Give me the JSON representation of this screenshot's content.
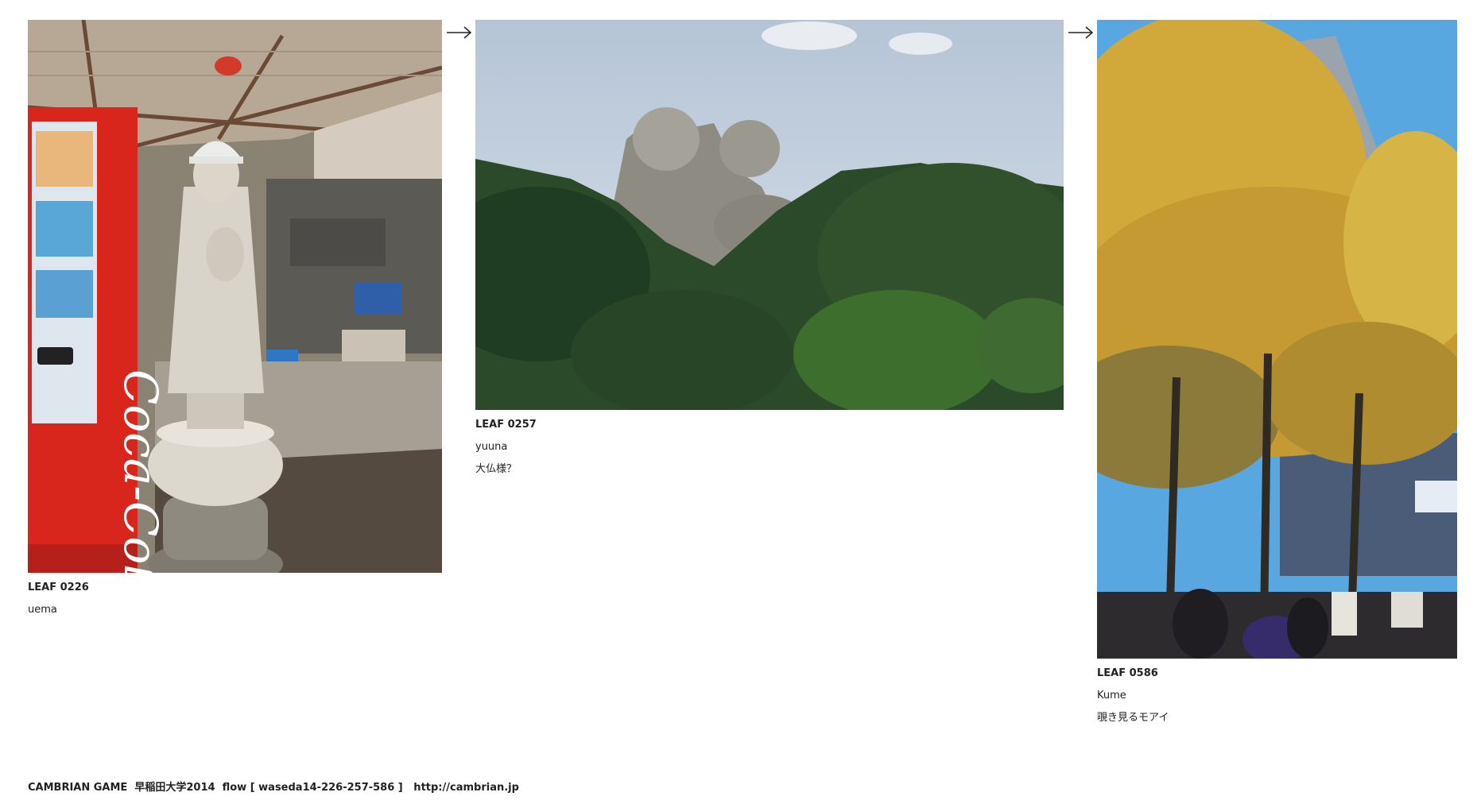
{
  "leaves": [
    {
      "label": "LEAF 0226",
      "author": "uema",
      "title": ""
    },
    {
      "label": "LEAF 0257",
      "author": "yuuna",
      "title": "大仏様？"
    },
    {
      "label": "LEAF 0586",
      "author": "Kume",
      "title": "覗き見るモアイ"
    }
  ],
  "footer": {
    "text": "CAMBRIAN GAME  早稲田大学2014  flow [ waseda14-226-257-586 ]   http://cambrian.jp"
  },
  "icons": {
    "flow_arrow": "right-arrow-icon"
  }
}
